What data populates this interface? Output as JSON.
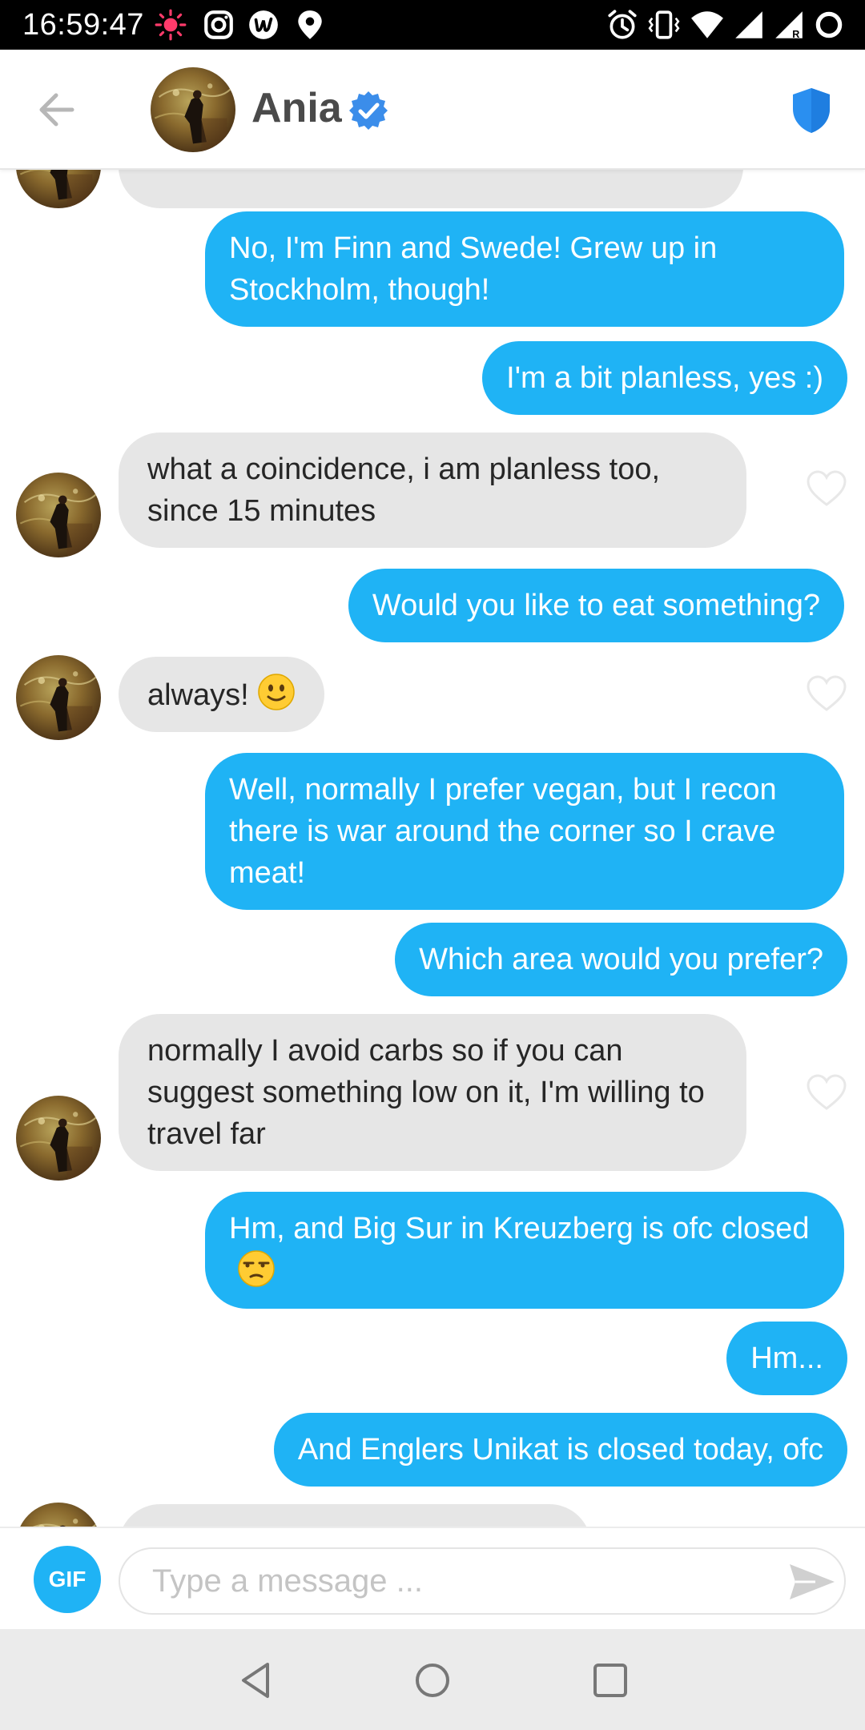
{
  "status_bar": {
    "time": "16:59:47",
    "icons": [
      "notification-dot-icon",
      "instagram-icon",
      "app-icon",
      "location-icon",
      "alarm-icon",
      "vibrate-icon",
      "wifi-icon",
      "signal-icon",
      "signal-roaming-icon",
      "battery-saver-icon"
    ]
  },
  "header": {
    "contact_name": "Ania",
    "verified": true,
    "icons": [
      "back-arrow-icon",
      "verified-badge-icon",
      "shield-icon"
    ]
  },
  "colors": {
    "outgoing_bubble": "#1fb3f5",
    "incoming_bubble": "#e6e6e6",
    "verified_badge": "#3b8dea",
    "shield": "#2a8ff0"
  },
  "messages": [
    {
      "direction": "in",
      "text": "",
      "partially_visible": true
    },
    {
      "direction": "out",
      "text": "No, I'm Finn and Swede! Grew up in Stockholm, though!"
    },
    {
      "direction": "out",
      "text": "I'm a bit planless, yes :)"
    },
    {
      "direction": "in",
      "text": "what a coincidence, i am planless too, since 15 minutes"
    },
    {
      "direction": "out",
      "text": "Would you like to eat something?"
    },
    {
      "direction": "in",
      "text": "always!",
      "emoji": "slightly-smiling-face"
    },
    {
      "direction": "out",
      "text": "Well, normally I prefer vegan, but I recon there is war around the corner so I crave meat!"
    },
    {
      "direction": "out",
      "text": "Which area would you prefer?"
    },
    {
      "direction": "in",
      "text": "normally I avoid carbs so if you can suggest something low on it, I'm willing to travel far"
    },
    {
      "direction": "out",
      "text": "Hm, and Big Sur in Kreuzberg is ofc closed",
      "emoji": "unamused-face"
    },
    {
      "direction": "out",
      "text": "Hm..."
    },
    {
      "direction": "out",
      "text": "And Englers Unikat is closed today, ofc"
    },
    {
      "direction": "in",
      "text": "",
      "partially_visible": true
    }
  ],
  "composer": {
    "gif_label": "GIF",
    "placeholder": "Type a message ...",
    "value": ""
  },
  "nav_bar": {
    "icons": [
      "back-triangle-icon",
      "home-circle-icon",
      "recents-square-icon"
    ]
  }
}
